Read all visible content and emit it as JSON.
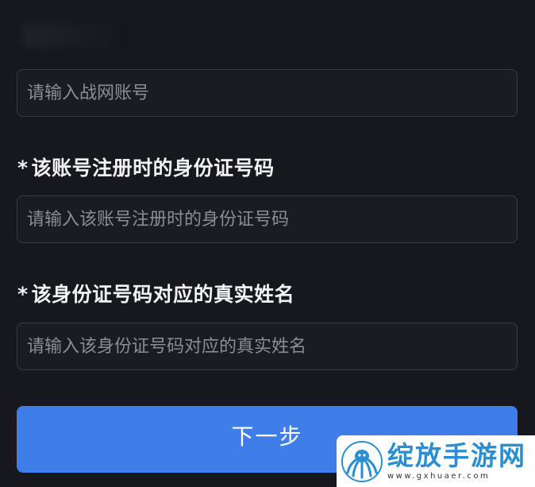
{
  "form": {
    "account_field": {
      "placeholder": "请输入战网账号",
      "value": ""
    },
    "id_number": {
      "required_mark": "*",
      "label": "该账号注册时的身份证号码",
      "placeholder": "请输入该账号注册时的身份证号码",
      "value": ""
    },
    "real_name": {
      "required_mark": "*",
      "label": "该身份证号码对应的真实姓名",
      "placeholder": "请输入该身份证号码对应的真实姓名",
      "value": ""
    },
    "next_button_label": "下一步"
  },
  "watermark": {
    "name": "绽放手游网",
    "url": "www.gxhuaer.com",
    "logo_icon": "octopus-logo-icon",
    "brand_color": "#2a8fd0"
  },
  "colors": {
    "background": "#17181e",
    "button": "#3f7ee8",
    "input_border": "#3a3c45",
    "placeholder": "#8b8d96"
  }
}
